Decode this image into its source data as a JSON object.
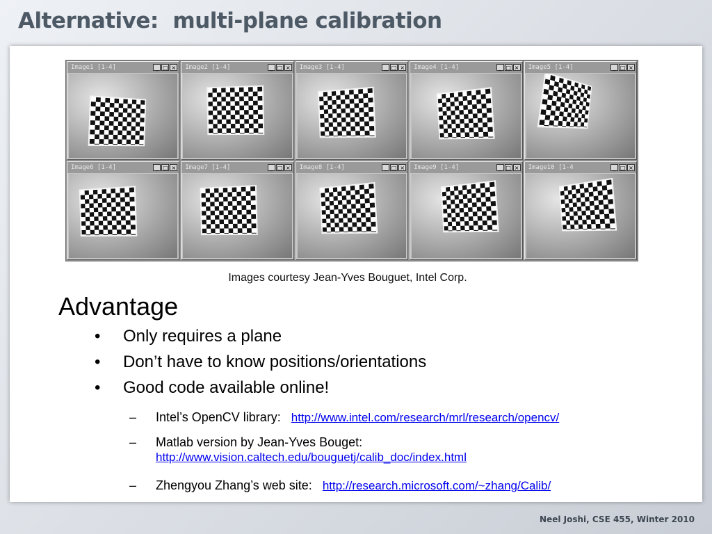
{
  "slide": {
    "title": "Alternative:  multi-plane calibration",
    "footer": "Neel Joshi, CSE 455, Winter 2010"
  },
  "figure": {
    "caption": "Images courtesy Jean-Yves Bouguet, Intel Corp.",
    "windows": [
      {
        "title": "Image1 [1-4]"
      },
      {
        "title": "Image2 [1-4]"
      },
      {
        "title": "Image3 [1-4]"
      },
      {
        "title": "Image4 [1-4]"
      },
      {
        "title": "Image5 [1-4]"
      },
      {
        "title": "Image6 [1-4]"
      },
      {
        "title": "Image7 [1-4]"
      },
      {
        "title": "Image8 [1-4]"
      },
      {
        "title": "Image9 [1-4]"
      },
      {
        "title": "Image10 [1-4"
      }
    ],
    "window_buttons": {
      "minimize": "_",
      "maximize": "□",
      "close": "×"
    }
  },
  "content": {
    "heading": "Advantage",
    "bullets": [
      "Only requires a plane",
      "Don’t have to know positions/orientations",
      "Good code available online!"
    ],
    "bullet_glyph": "•",
    "dash_glyph": "–",
    "sub_items": [
      {
        "text": "Intel’s OpenCV library:",
        "link": "http://www.intel.com/research/mrl/research/opencv/"
      },
      {
        "text": "Matlab version by Jean-Yves Bouget:",
        "link": "http://www.vision.caltech.edu/bouguetj/calib_doc/index.html"
      },
      {
        "text": "Zhengyou Zhang’s web site:",
        "link": "http://research.microsoft.com/~zhang/Calib/"
      }
    ]
  },
  "colors": {
    "title": "#4d5a66",
    "link": "#0000ee",
    "footer": "#3d4650"
  }
}
